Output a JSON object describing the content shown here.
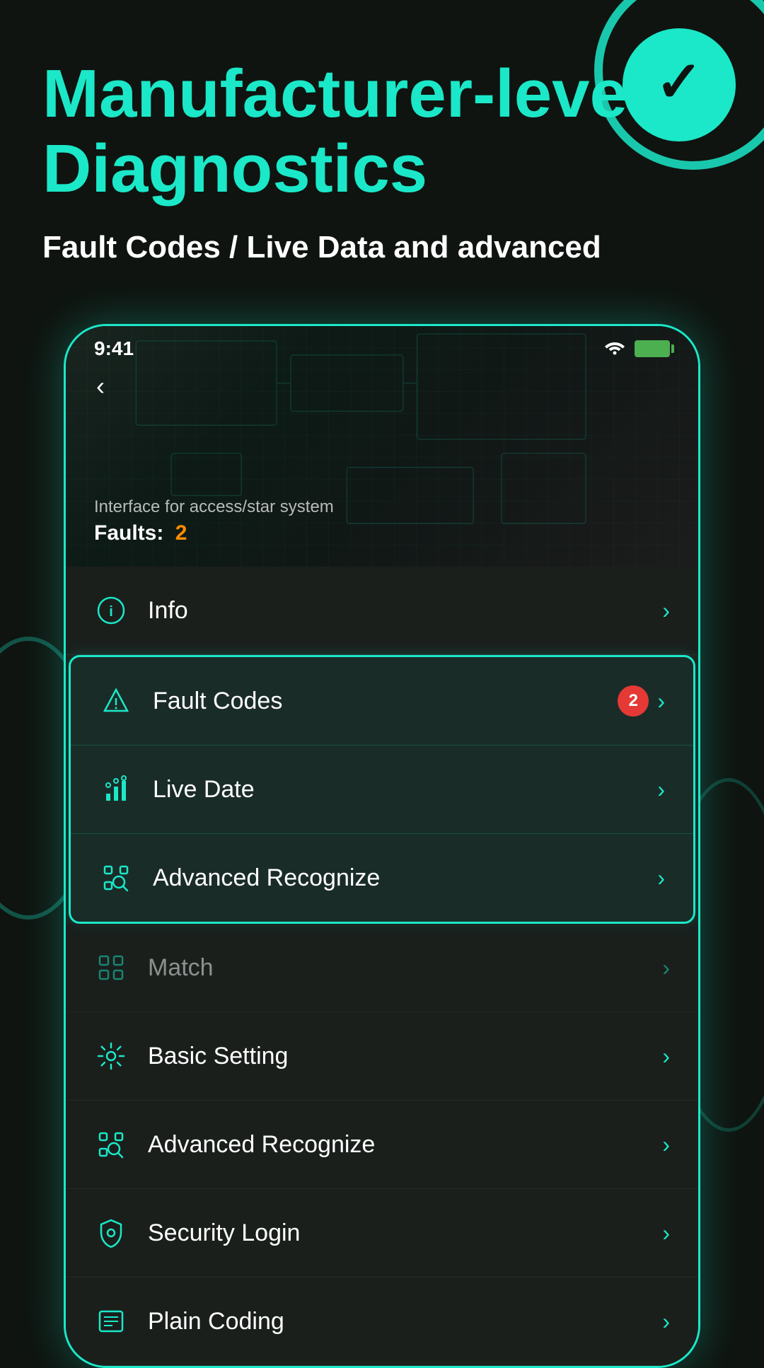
{
  "header": {
    "main_title": "Manufacturer-level Diagnostics",
    "subtitle": "Fault Codes / Live Data and advanced"
  },
  "status_bar": {
    "time": "9:41",
    "wifi": "wifi",
    "battery": "battery"
  },
  "hero": {
    "interface_text": "Interface for access/star system",
    "faults_label": "Faults:",
    "faults_count": "2"
  },
  "menu_items": [
    {
      "id": "info",
      "label": "Info",
      "icon": "info",
      "badge": null,
      "highlighted": false
    },
    {
      "id": "fault-codes",
      "label": "Fault Codes",
      "icon": "alert",
      "badge": "2",
      "highlighted": true
    },
    {
      "id": "live-date",
      "label": "Live Date",
      "icon": "chart",
      "badge": null,
      "highlighted": true
    },
    {
      "id": "advanced-recognize",
      "label": "Advanced Recognize",
      "icon": "scan",
      "badge": null,
      "highlighted": true
    },
    {
      "id": "match",
      "label": "Match",
      "icon": "match",
      "badge": null,
      "highlighted": false,
      "dimmed": true
    },
    {
      "id": "basic-setting",
      "label": "Basic Setting",
      "icon": "gear",
      "badge": null,
      "highlighted": false
    },
    {
      "id": "advanced-recognize-2",
      "label": "Advanced Recognize",
      "icon": "scan",
      "badge": null,
      "highlighted": false
    },
    {
      "id": "security-login",
      "label": "Security Login",
      "icon": "shield",
      "badge": null,
      "highlighted": false
    },
    {
      "id": "plain-coding",
      "label": "Plain Coding",
      "icon": "list",
      "badge": null,
      "highlighted": false
    }
  ],
  "colors": {
    "accent": "#1be8c8",
    "background": "#0f1410",
    "card": "#1a1f1c",
    "badge": "#e53935",
    "fault_number": "#ff8c00"
  }
}
